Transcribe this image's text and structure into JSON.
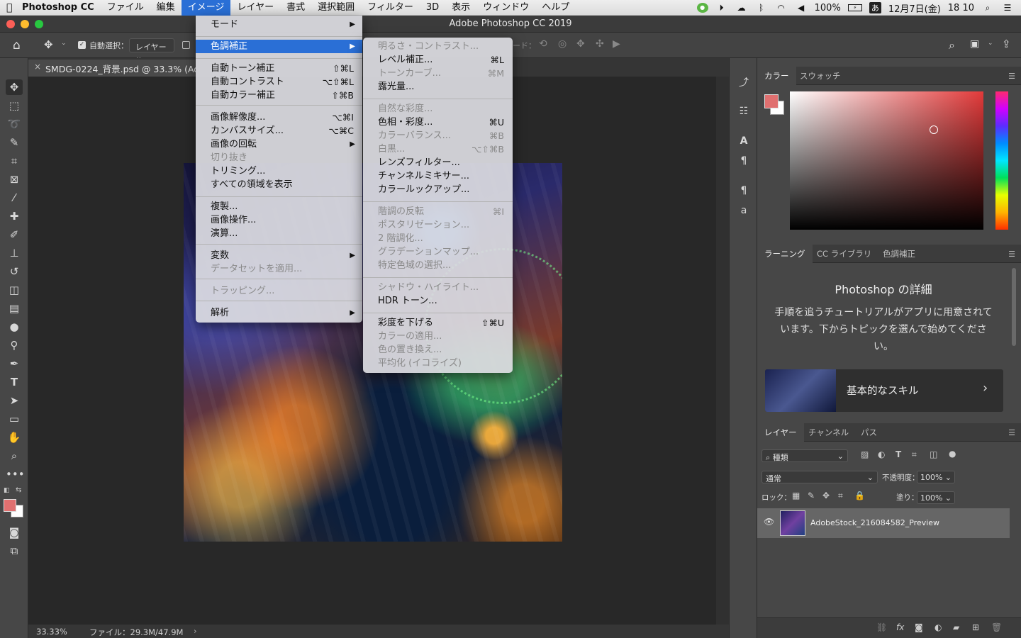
{
  "menubar": {
    "apple": "",
    "app": "Photoshop CC",
    "items": [
      "ファイル",
      "編集",
      "イメージ",
      "レイヤー",
      "書式",
      "選択範囲",
      "フィルター",
      "3D",
      "表示",
      "ウィンドウ",
      "ヘルプ"
    ],
    "active_index": 2,
    "status": {
      "battery": "100%",
      "date": "12月7日(金)",
      "time": "18 10",
      "input_method": "あ"
    }
  },
  "window": {
    "title": "Adobe Photoshop CC 2019"
  },
  "options": {
    "auto_select_label": "自動選択：",
    "auto_select_value": "レイヤー",
    "mode_partial": "ード："
  },
  "document": {
    "tab_title": "SMDG-0224_背景.psd @ 33.3% (Ado",
    "zoom": "33.33%",
    "file_info": "ファイル：29.3M/47.9M"
  },
  "image_menu": [
    {
      "label": "モード",
      "arrow": "▶"
    },
    {
      "label": "色調補正",
      "arrow": "▶",
      "highlighted": true
    },
    {
      "label": "自動トーン補正",
      "shortcut": "⇧⌘L"
    },
    {
      "label": "自動コントラスト",
      "shortcut": "⌥⇧⌘L"
    },
    {
      "label": "自動カラー補正",
      "shortcut": "⇧⌘B"
    },
    {
      "label": "画像解像度...",
      "shortcut": "⌥⌘I"
    },
    {
      "label": "カンバスサイズ...",
      "shortcut": "⌥⌘C"
    },
    {
      "label": "画像の回転",
      "arrow": "▶"
    },
    {
      "label": "切り抜き",
      "disabled": true
    },
    {
      "label": "トリミング..."
    },
    {
      "label": "すべての領域を表示"
    },
    {
      "label": "複製..."
    },
    {
      "label": "画像操作..."
    },
    {
      "label": "演算..."
    },
    {
      "label": "変数",
      "arrow": "▶"
    },
    {
      "label": "データセットを適用...",
      "disabled": true
    },
    {
      "label": "トラッピング...",
      "disabled": true
    },
    {
      "label": "解析",
      "arrow": "▶"
    }
  ],
  "adjust_menu": [
    {
      "label": "明るさ・コントラスト...",
      "disabled": true
    },
    {
      "label": "レベル補正...",
      "shortcut": "⌘L"
    },
    {
      "label": "トーンカーブ...",
      "shortcut": "⌘M",
      "disabled": true
    },
    {
      "label": "露光量..."
    },
    {
      "label": "自然な彩度...",
      "disabled": true
    },
    {
      "label": "色相・彩度...",
      "shortcut": "⌘U"
    },
    {
      "label": "カラーバランス...",
      "shortcut": "⌘B",
      "disabled": true
    },
    {
      "label": "白黒...",
      "shortcut": "⌥⇧⌘B",
      "disabled": true
    },
    {
      "label": "レンズフィルター..."
    },
    {
      "label": "チャンネルミキサー..."
    },
    {
      "label": "カラールックアップ..."
    },
    {
      "label": "階調の反転",
      "shortcut": "⌘I",
      "disabled": true
    },
    {
      "label": "ポスタリゼーション...",
      "disabled": true
    },
    {
      "label": "2 階調化...",
      "disabled": true
    },
    {
      "label": "グラデーションマップ...",
      "disabled": true
    },
    {
      "label": "特定色域の選択...",
      "disabled": true
    },
    {
      "label": "シャドウ・ハイライト...",
      "disabled": true
    },
    {
      "label": "HDR トーン..."
    },
    {
      "label": "彩度を下げる",
      "shortcut": "⇧⌘U"
    },
    {
      "label": "カラーの適用...",
      "disabled": true
    },
    {
      "label": "色の置き換え...",
      "disabled": true
    },
    {
      "label": "平均化 (イコライズ)",
      "disabled": true
    }
  ],
  "color_panel": {
    "tabs": [
      "カラー",
      "スウォッチ"
    ],
    "foreground": "#e07070",
    "hue_color": "#e23a3a"
  },
  "learn_panel": {
    "tabs": [
      "ラーニング",
      "CC ライブラリ",
      "色調補正"
    ],
    "title": "Photoshop の詳細",
    "body": "手順を追うチュートリアルがアプリに用意されています。下からトピックを選んで始めてください。",
    "card": "基本的なスキル"
  },
  "layers_panel": {
    "tabs": [
      "レイヤー",
      "チャンネル",
      "パス"
    ],
    "filter": "種類",
    "blend": "通常",
    "opacity_label": "不透明度：",
    "opacity": "100%",
    "lock_label": "ロック：",
    "fill_label": "塗り：",
    "fill": "100%",
    "layers": [
      {
        "name": "AdobeStock_216084582_Preview",
        "visible": true
      }
    ]
  }
}
